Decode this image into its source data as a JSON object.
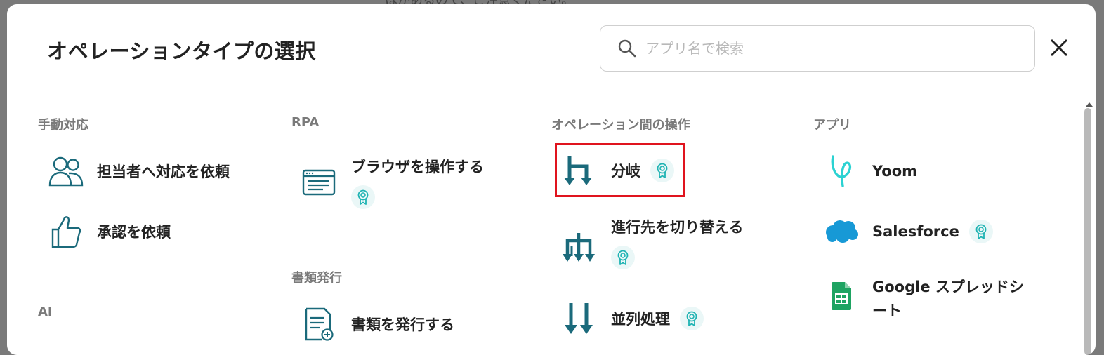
{
  "backdrop": {
    "top_text": "はがあるので、ご注意ください。"
  },
  "modal": {
    "title": "オペレーションタイプの選択",
    "search": {
      "placeholder": "アプリ名で検索",
      "value": ""
    },
    "close_icon": "close-icon"
  },
  "sections": {
    "manual": {
      "label": "手動対応",
      "items": [
        {
          "label": "担当者へ対応を依頼",
          "icon": "people-icon"
        },
        {
          "label": "承認を依頼",
          "icon": "thumbs-up-icon"
        }
      ]
    },
    "ai": {
      "label": "AI"
    },
    "rpa": {
      "label": "RPA",
      "items": [
        {
          "label": "ブラウザを操作する",
          "icon": "browser-icon",
          "premium": true
        }
      ]
    },
    "documents": {
      "label": "書類発行",
      "items": [
        {
          "label": "書類を発行する",
          "icon": "document-add-icon"
        }
      ]
    },
    "operations": {
      "label": "オペレーション間の操作",
      "items": [
        {
          "label": "分岐",
          "icon": "branch-icon",
          "premium": true,
          "highlighted": true
        },
        {
          "label": "進行先を切り替える",
          "icon": "switch-path-icon",
          "premium": true
        },
        {
          "label": "並列処理",
          "icon": "parallel-icon",
          "premium": true
        }
      ]
    },
    "apps": {
      "label": "アプリ",
      "items": [
        {
          "label": "Yoom",
          "icon": "yoom-logo-icon"
        },
        {
          "label": "Salesforce",
          "icon": "salesforce-logo-icon",
          "premium": true
        },
        {
          "label": "Google スプレッドシート",
          "icon": "google-sheets-icon"
        }
      ]
    }
  },
  "colors": {
    "accent": "#1b6a7b",
    "badge_bg": "#eaf7f7",
    "badge_icon": "#1fb3b3",
    "highlight": "#e0141e"
  }
}
